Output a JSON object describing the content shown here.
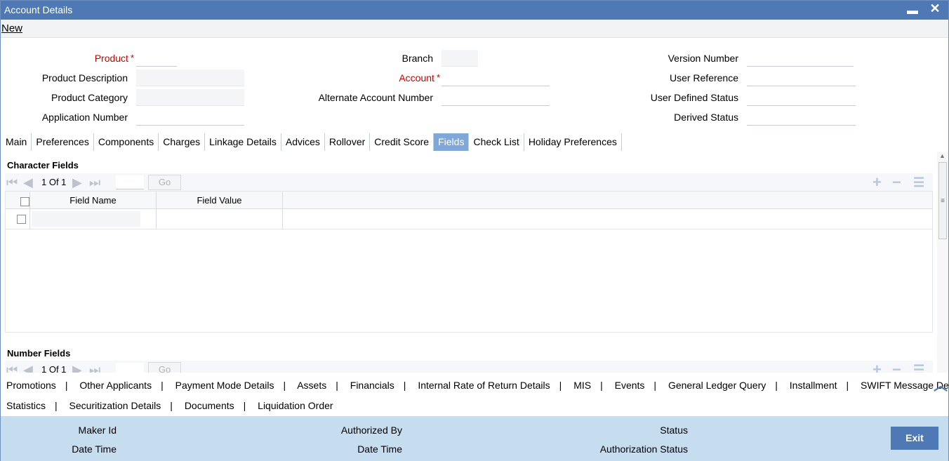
{
  "window": {
    "title": "Account Details",
    "minimize": "▬",
    "close": "✕"
  },
  "menu": {
    "new_label": "New"
  },
  "form": {
    "product_label": "Product",
    "product_desc_label": "Product Description",
    "product_category_label": "Product Category",
    "application_number_label": "Application Number",
    "branch_label": "Branch",
    "account_label": "Account",
    "alt_account_label": "Alternate Account Number",
    "version_number_label": "Version Number",
    "user_reference_label": "User Reference",
    "user_defined_status_label": "User Defined Status",
    "derived_status_label": "Derived Status",
    "required_mark": "*"
  },
  "tabs": [
    {
      "label": "Main"
    },
    {
      "label": "Preferences"
    },
    {
      "label": "Components"
    },
    {
      "label": "Charges"
    },
    {
      "label": "Linkage Details"
    },
    {
      "label": "Advices"
    },
    {
      "label": "Rollover"
    },
    {
      "label": "Credit Score"
    },
    {
      "label": "Fields",
      "active": true
    },
    {
      "label": "Check List"
    },
    {
      "label": "Holiday Preferences"
    }
  ],
  "character_fields": {
    "title": "Character Fields",
    "pager": "1 Of 1",
    "go_label": "Go",
    "col_field_name": "Field Name",
    "col_field_value": "Field Value"
  },
  "number_fields": {
    "title": "Number Fields",
    "pager": "1 Of 1",
    "go_label": "Go"
  },
  "bottom_links_row1": [
    "Promotions",
    "Other Applicants",
    "Payment Mode Details",
    "Assets",
    "Financials",
    "Internal Rate of Return Details",
    "MIS",
    "Events",
    "General Ledger Query",
    "Installment",
    "SWIFT Message Details"
  ],
  "bottom_links_row2": [
    "Statistics",
    "Securitization Details",
    "Documents",
    "Liquidation Order"
  ],
  "footer": {
    "maker_id": "Maker Id",
    "date_time_1": "Date Time",
    "authorized_by": "Authorized By",
    "date_time_2": "Date Time",
    "status": "Status",
    "authorization_status": "Authorization Status",
    "exit_label": "Exit"
  },
  "colors": {
    "titlebar": "#4f79b5",
    "active_tab": "#7fa8d8",
    "footer": "#c6dcef",
    "required": "#cc0000"
  }
}
